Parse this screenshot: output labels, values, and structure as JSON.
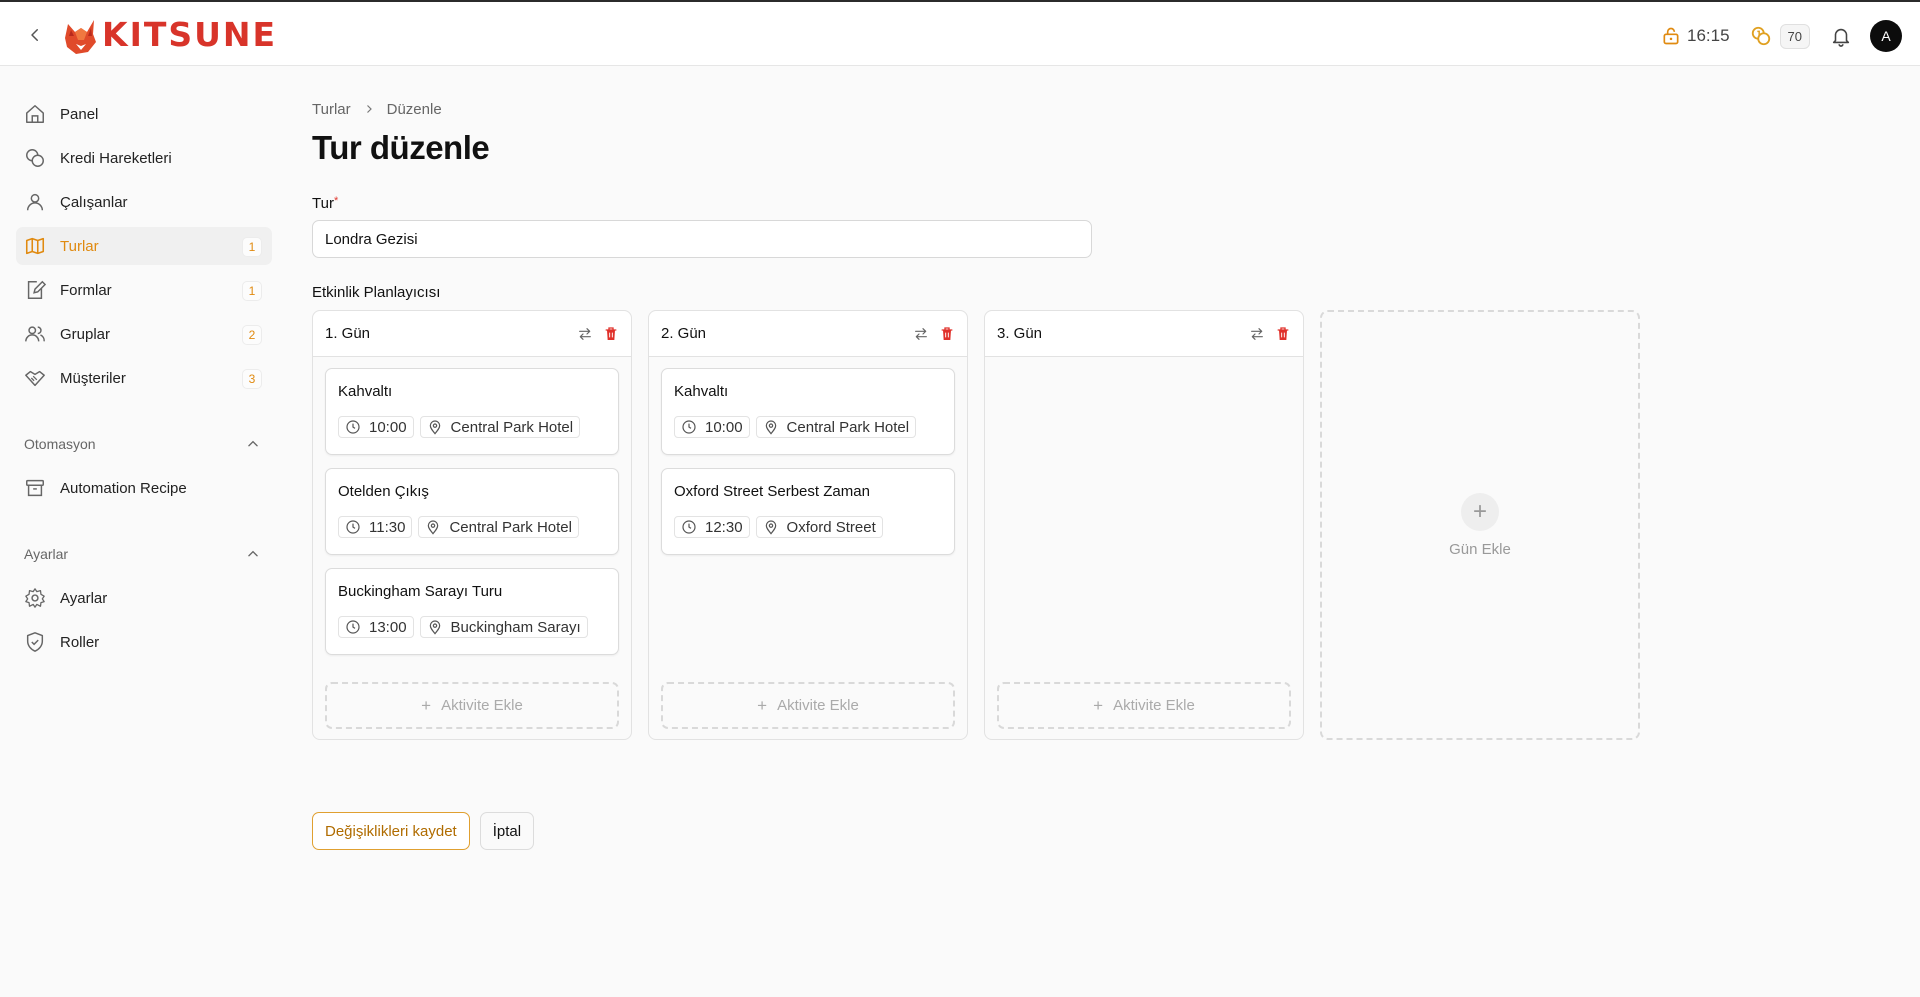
{
  "brand": {
    "name": "KITSUNE",
    "color": "#d8342a"
  },
  "header": {
    "time": "16:15",
    "credits": "70",
    "avatar_initial": "A"
  },
  "sidebar": {
    "items": [
      {
        "label": "Panel",
        "icon": "home-icon"
      },
      {
        "label": "Kredi Hareketleri",
        "icon": "coins-icon"
      },
      {
        "label": "Çalışanlar",
        "icon": "user-icon"
      },
      {
        "label": "Turlar",
        "icon": "map-icon",
        "badge": "1",
        "active": true
      },
      {
        "label": "Formlar",
        "icon": "form-edit-icon",
        "badge": "1"
      },
      {
        "label": "Gruplar",
        "icon": "users-icon",
        "badge": "2"
      },
      {
        "label": "Müşteriler",
        "icon": "handshake-icon",
        "badge": "3"
      }
    ],
    "sections": [
      {
        "title": "Otomasyon",
        "items": [
          {
            "label": "Automation Recipe",
            "icon": "archive-icon"
          }
        ]
      },
      {
        "title": "Ayarlar",
        "items": [
          {
            "label": "Ayarlar",
            "icon": "gear-icon"
          },
          {
            "label": "Roller",
            "icon": "shield-check-icon"
          }
        ]
      }
    ]
  },
  "breadcrumb": [
    "Turlar",
    "Düzenle"
  ],
  "page_title": "Tur düzenle",
  "form": {
    "tour_label": "Tur",
    "required_mark": "*",
    "tour_value": "Londra Gezisi",
    "planner_label": "Etkinlik Planlayıcısı"
  },
  "days": [
    {
      "title": "1. Gün",
      "activities": [
        {
          "title": "Kahvaltı",
          "time": "10:00",
          "location": "Central Park Hotel"
        },
        {
          "title": "Otelden Çıkış",
          "time": "11:30",
          "location": "Central Park Hotel"
        },
        {
          "title": "Buckingham Sarayı Turu",
          "time": "13:00",
          "location": "Buckingham Sarayı"
        }
      ]
    },
    {
      "title": "2. Gün",
      "activities": [
        {
          "title": "Kahvaltı",
          "time": "10:00",
          "location": "Central Park Hotel"
        },
        {
          "title": "Oxford Street Serbest Zaman",
          "time": "12:30",
          "location": "Oxford Street"
        }
      ]
    },
    {
      "title": "3. Gün",
      "activities": []
    }
  ],
  "add_activity_label": "Aktivite Ekle",
  "add_day_label": "Gün Ekle",
  "buttons": {
    "save": "Değişiklikleri kaydet",
    "cancel": "İptal"
  },
  "colors": {
    "accent": "#e08a10",
    "danger": "#e0302a"
  }
}
